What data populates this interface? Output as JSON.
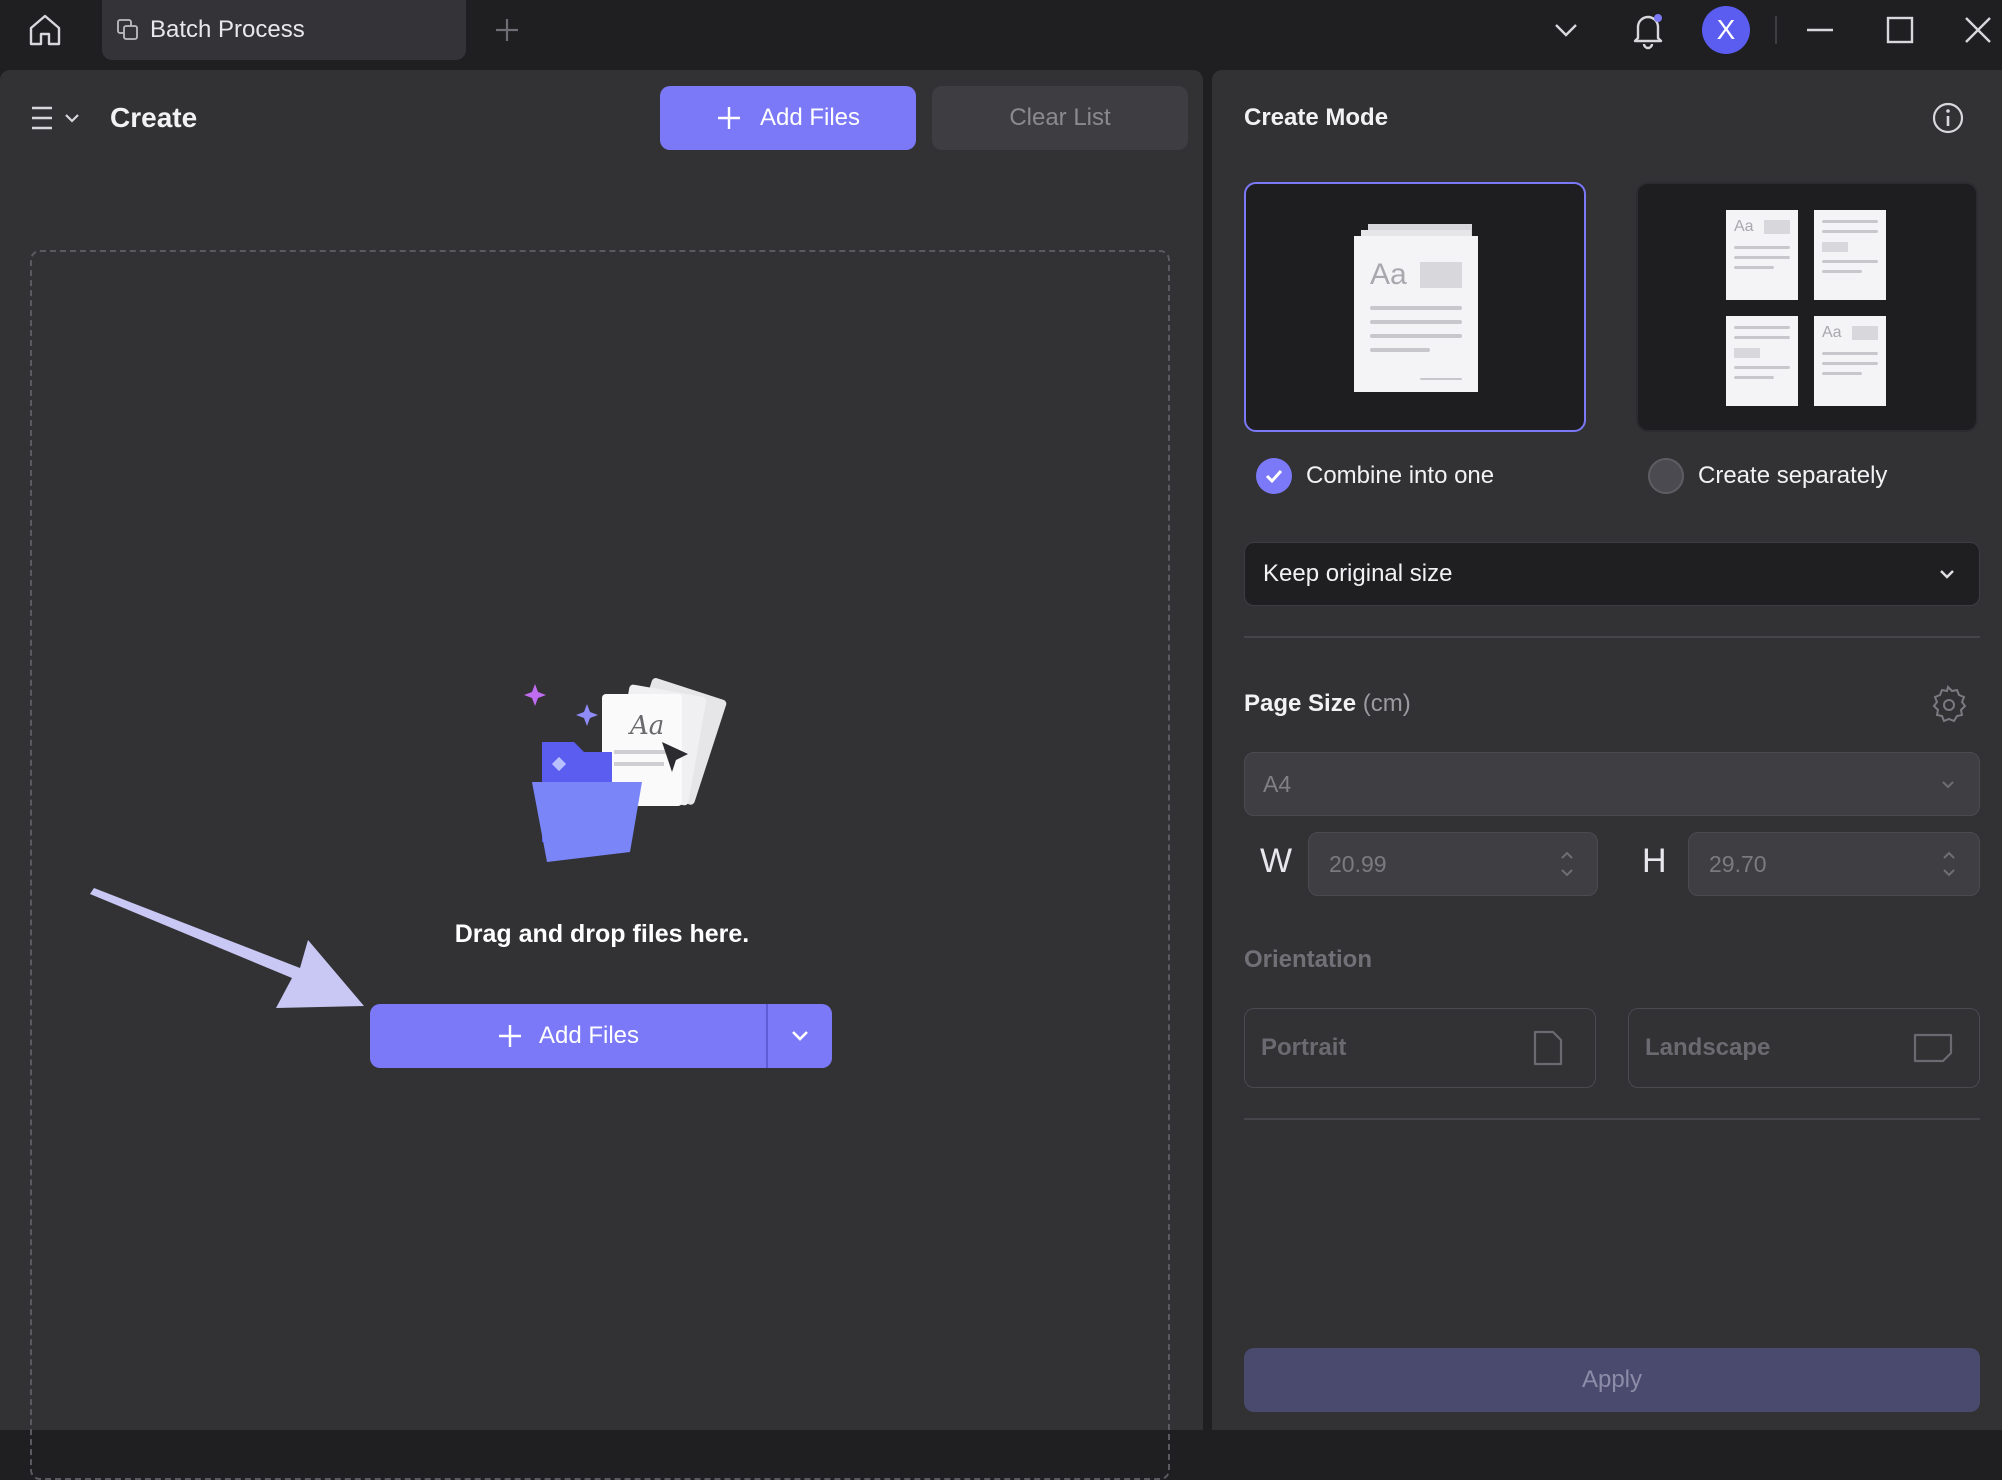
{
  "titlebar": {
    "tab_label": "Batch Process",
    "avatar_letter": "X",
    "icons": [
      "home-icon",
      "batch-icon",
      "plus-icon",
      "chevron-down-icon",
      "bell-icon",
      "minimize-icon",
      "maximize-icon",
      "close-icon"
    ]
  },
  "left": {
    "title": "Create",
    "add_files_label": "Add Files",
    "clear_list_label": "Clear List",
    "dropzone_text": "Drag and drop files here.",
    "dropzone_add_files_label": "Add Files"
  },
  "right": {
    "title": "Create Mode",
    "mode_combine_label": "Combine into one",
    "mode_separate_label": "Create separately",
    "mode_combine_checked": true,
    "size_select_value": "Keep original size",
    "page_size_title": "Page Size",
    "page_size_unit": "(cm)",
    "page_size_value": "A4",
    "width_label": "W",
    "width_value": "20.99",
    "height_label": "H",
    "height_value": "29.70",
    "orientation_title": "Orientation",
    "portrait_label": "Portrait",
    "landscape_label": "Landscape",
    "apply_label": "Apply",
    "thumb_text": "Aa"
  },
  "colors": {
    "accent": "#7b79f7",
    "panel": "#323235",
    "background": "#1f1f22",
    "apply_disabled": "#4a4a6e"
  }
}
